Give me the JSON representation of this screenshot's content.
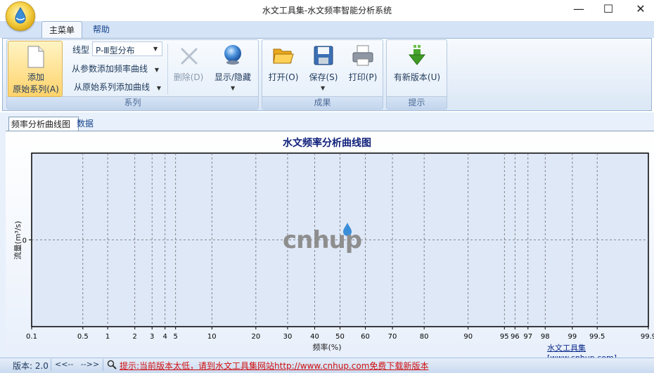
{
  "window": {
    "title": "水文工具集-水文频率智能分析系统",
    "minimize": "—",
    "maximize": "☐",
    "close": "✕"
  },
  "ribbon": {
    "tabs": {
      "main": "主菜单",
      "help": "帮助"
    },
    "groups": {
      "series": {
        "label": "系列",
        "add_original_line1": "添加",
        "add_original_line2": "原始系列(A)",
        "line_type_label": "线型",
        "line_type_value": "P-Ⅲ型分布",
        "add_from_params": "从参数添加频率曲线",
        "add_from_series": "从原始系列添加曲线",
        "delete": "删除(D)",
        "show_hide": "显示/隐藏"
      },
      "results": {
        "label": "成果",
        "open": "打开(O)",
        "save": "保存(S)",
        "print": "打印(P)"
      },
      "tips": {
        "label": "提示",
        "new_version": "有新版本(U)"
      }
    }
  },
  "content": {
    "tabs": {
      "curve": "频率分析曲线图",
      "data": "数据"
    }
  },
  "chart_data": {
    "type": "line",
    "title": "水文频率分析曲线图",
    "xlabel": "频率(%)",
    "ylabel": "流量(m³/s)",
    "x_scale": "probability",
    "xticks": [
      "0.1",
      "0.5",
      "1",
      "2",
      "3",
      "4",
      "5",
      "10",
      "20",
      "30",
      "40",
      "50",
      "60",
      "70",
      "80",
      "90",
      "95",
      "96",
      "97",
      "98",
      "99",
      "99.5",
      "99.9"
    ],
    "yticks": [
      "0"
    ],
    "series": [],
    "grid": true,
    "watermark": "cnhup",
    "footer_link": "水文工具集[www.cnhup.com]"
  },
  "status": {
    "version": "版本: 2.0",
    "nav": "<<--   -->>",
    "tip": "提示:当前版本太低，请到水文工具集网站http://www.cnhup.com免费下载新版本"
  }
}
